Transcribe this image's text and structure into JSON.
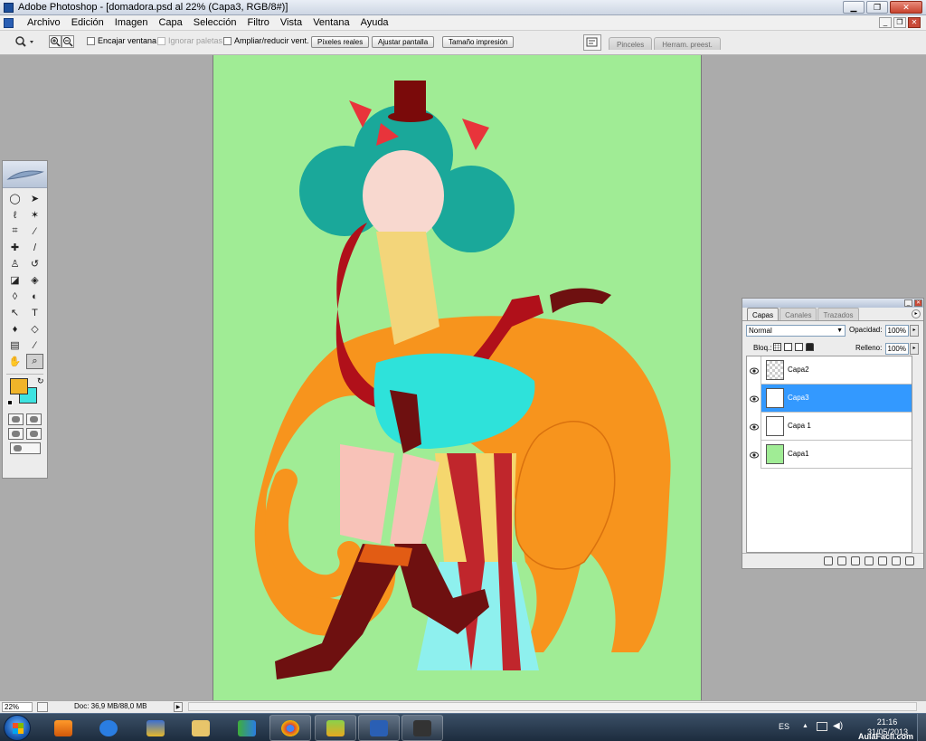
{
  "window": {
    "title": "Adobe Photoshop - [domadora.psd al 22% (Capa3, RGB/8#)]",
    "controls": [
      "minimize-icon",
      "restore-icon",
      "close-icon"
    ]
  },
  "menu": {
    "items": [
      "Archivo",
      "Edición",
      "Imagen",
      "Capa",
      "Selección",
      "Filtro",
      "Vista",
      "Ventana",
      "Ayuda"
    ]
  },
  "options": {
    "encajar_ventana": "Encajar ventana",
    "ignorar_paletas": "Ignorar paletas",
    "ampliar_reducir": "Ampliar/reducir vent.",
    "btn_pixeles_reales": "Píxeles reales",
    "btn_ajustar_pantalla": "Ajustar pantalla",
    "btn_tamano_impresion": "Tamaño impresión",
    "well_tabs": [
      "Pinceles",
      "Herram. preest."
    ]
  },
  "toolbox": {
    "foreground_color": "#f0b429",
    "background_color": "#3ee3e0",
    "tools": [
      {
        "name": "marquee-tool-icon",
        "glyph": "◯"
      },
      {
        "name": "move-tool-icon",
        "glyph": "➤"
      },
      {
        "name": "lasso-tool-icon",
        "glyph": "ℓ"
      },
      {
        "name": "magic-wand-icon",
        "glyph": "✶"
      },
      {
        "name": "crop-tool-icon",
        "glyph": "⌗"
      },
      {
        "name": "slice-tool-icon",
        "glyph": "⁄"
      },
      {
        "name": "healing-brush-icon",
        "glyph": "✚"
      },
      {
        "name": "brush-tool-icon",
        "glyph": "/"
      },
      {
        "name": "clone-stamp-icon",
        "glyph": "♙"
      },
      {
        "name": "history-brush-icon",
        "glyph": "↺"
      },
      {
        "name": "eraser-tool-icon",
        "glyph": "◪"
      },
      {
        "name": "paint-bucket-icon",
        "glyph": "◈"
      },
      {
        "name": "blur-tool-icon",
        "glyph": "◊"
      },
      {
        "name": "dodge-tool-icon",
        "glyph": "◐"
      },
      {
        "name": "path-selection-icon",
        "glyph": "↖"
      },
      {
        "name": "type-tool-icon",
        "glyph": "T"
      },
      {
        "name": "pen-tool-icon",
        "glyph": "♦"
      },
      {
        "name": "shape-tool-icon",
        "glyph": "◇"
      },
      {
        "name": "notes-tool-icon",
        "glyph": "▤"
      },
      {
        "name": "eyedropper-icon",
        "glyph": "⁄"
      },
      {
        "name": "hand-tool-icon",
        "glyph": "✋"
      },
      {
        "name": "zoom-tool-icon",
        "glyph": "⌕"
      }
    ]
  },
  "layers_panel": {
    "tabs": [
      "Capas",
      "Canales",
      "Trazados"
    ],
    "blend_mode": "Normal",
    "opacity_label": "Opacidad:",
    "opacity_value": "100%",
    "lock_label": "Bloq.:",
    "fill_label": "Relleno:",
    "fill_value": "100%",
    "layers": [
      {
        "name": "Capa2",
        "thumb": "transparent",
        "selected": false
      },
      {
        "name": "Capa3",
        "thumb": "figure",
        "selected": true
      },
      {
        "name": "Capa 1",
        "thumb": "white",
        "selected": false
      },
      {
        "name": "Capa1",
        "thumb": "green",
        "selected": false
      }
    ]
  },
  "status": {
    "zoom": "22%",
    "doc_info": "Doc: 36,9 MB/88,0 MB"
  },
  "taskbar": {
    "language": "ES",
    "time": "21:16",
    "date": "31/05/2013",
    "watermark": "AulaFacil.com"
  }
}
